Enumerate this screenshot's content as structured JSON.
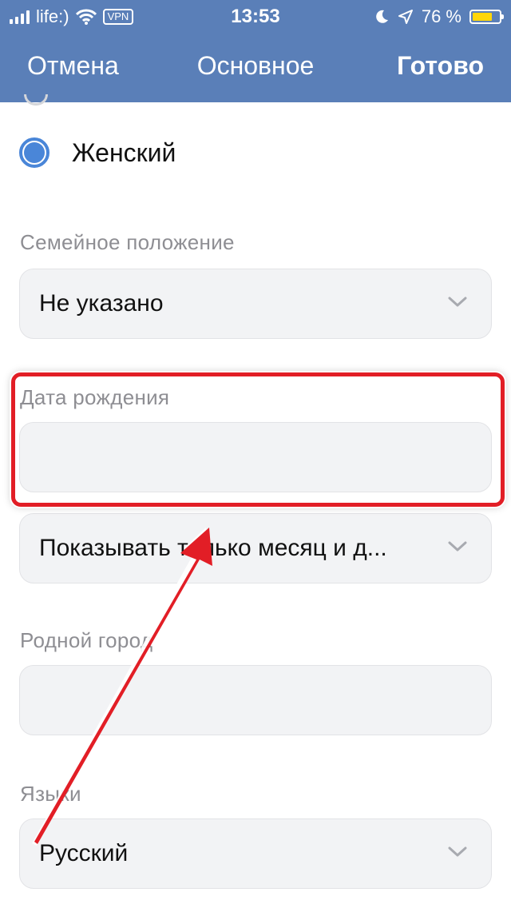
{
  "status_bar": {
    "carrier": "life:)",
    "vpn": "VPN",
    "time": "13:53",
    "battery_text": "76 %",
    "battery_level": 0.76
  },
  "nav": {
    "cancel": "Отмена",
    "title": "Основное",
    "done": "Готово"
  },
  "gender": {
    "selected_label": "Женский",
    "selected": true
  },
  "marital_status": {
    "label": "Семейное положение",
    "value": "Не указано"
  },
  "birth_date": {
    "label": "Дата рождения",
    "value": ""
  },
  "birth_visibility": {
    "value": "Показывать только месяц и д..."
  },
  "home_city": {
    "label": "Родной город",
    "value": ""
  },
  "languages": {
    "label": "Языки",
    "value": "Русский"
  },
  "annotation": {
    "highlight_color": "#e21e26"
  },
  "colors": {
    "nav_background": "#5a7fb8",
    "radio_accent": "#4a86d8",
    "field_background": "#f2f3f5"
  }
}
